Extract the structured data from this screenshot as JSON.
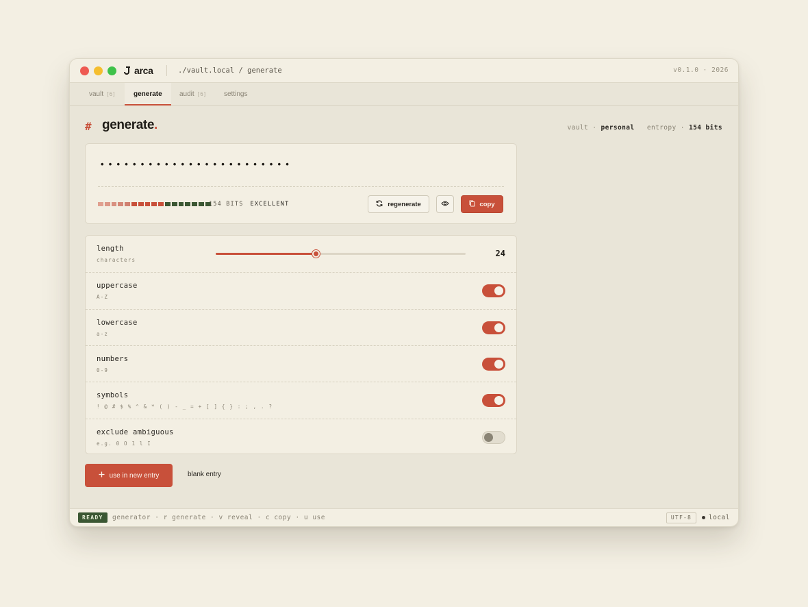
{
  "window": {
    "brand": "arca",
    "path": "./vault.local / generate",
    "version": "v0.1.0 · 2026"
  },
  "tabs": [
    {
      "label": "vault",
      "count": "[6]"
    },
    {
      "label": "generate",
      "count": ""
    },
    {
      "label": "audit",
      "count": "[6]"
    },
    {
      "label": "settings",
      "count": ""
    }
  ],
  "heading": {
    "hash": "#",
    "title": "generate",
    "dot": "."
  },
  "meta": {
    "vault_label": "vault ·",
    "vault_value": "personal",
    "entropy_label": "entropy ·",
    "entropy_value": "154 bits"
  },
  "password": {
    "masked": "••••••••••••••••••••••••",
    "strength_bits": "154 BITS",
    "strength_rating": "EXCELLENT",
    "strength_segments": [
      "#e0a090",
      "#dc9888",
      "#d89080",
      "#d48878",
      "#d08070",
      "#c8503a",
      "#c8503a",
      "#c8503a",
      "#c8503a",
      "#c8503a",
      "#3b5733",
      "#3b5733",
      "#3b5733",
      "#3b5733",
      "#3b5733",
      "#3b5733",
      "#3b5733"
    ]
  },
  "buttons": {
    "regenerate": "regenerate",
    "copy": "copy",
    "use_new_entry": "use in new entry",
    "blank_entry": "blank entry"
  },
  "options": {
    "length": {
      "label": "length",
      "sub": "characters",
      "value": "24",
      "fraction": 0.4
    },
    "uppercase": {
      "label": "uppercase",
      "sub": "A-Z",
      "on": true
    },
    "lowercase": {
      "label": "lowercase",
      "sub": "a-z",
      "on": true
    },
    "numbers": {
      "label": "numbers",
      "sub": "0-9",
      "on": true
    },
    "symbols": {
      "label": "symbols",
      "sub": "! @ # $ % ^ & * ( ) - _ = + [ ] { } : ; , . ?",
      "on": true
    },
    "exclude": {
      "label": "exclude ambiguous",
      "sub": "e.g. 0 O 1 l I",
      "on": false
    }
  },
  "statusbar": {
    "ready": "READY",
    "shortcuts": "generator · r generate · v reveal · c copy · u use",
    "encoding": "UTF-8",
    "location": "local"
  },
  "colors": {
    "accent": "#c8503a",
    "success": "#3b5733",
    "background": "#e9e5d8"
  }
}
